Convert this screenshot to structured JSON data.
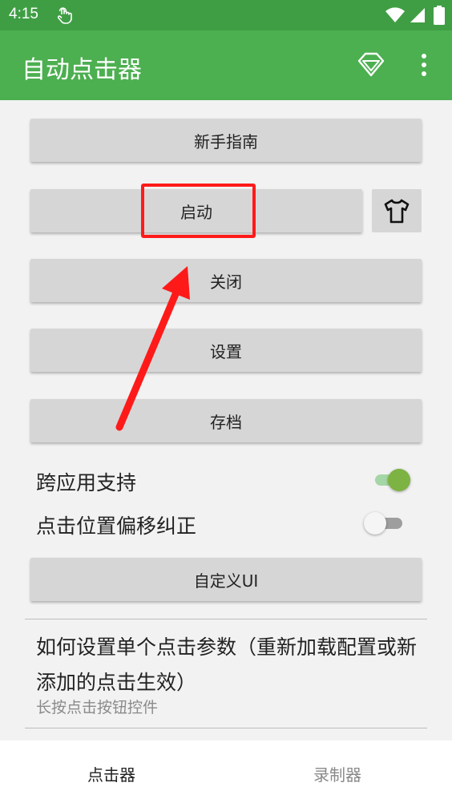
{
  "status_bar": {
    "time": "4:15",
    "icons": [
      "touch-icon",
      "wifi-icon",
      "cell-signal-icon",
      "battery-icon"
    ]
  },
  "app_bar": {
    "title": "自动点击器",
    "actions": [
      "diamond-icon",
      "more-vert-icon"
    ]
  },
  "buttons": {
    "guide": "新手指南",
    "start": "启动",
    "skin_icon": "tshirt-icon",
    "close": "关闭",
    "settings": "设置",
    "archive": "存档",
    "custom_ui": "自定义UI"
  },
  "toggles": [
    {
      "label": "跨应用支持",
      "on": true
    },
    {
      "label": "点击位置偏移纠正",
      "on": false
    }
  ],
  "help": {
    "title": "如何设置单个点击参数（重新加载配置或新添加的点击生效）",
    "subtitle": "长按点击按钮控件"
  },
  "bottom_nav": {
    "tabs": [
      "点击器",
      "录制器"
    ],
    "selected": "点击器"
  },
  "colors": {
    "status_bar": "#3f9e44",
    "app_bar": "#4caf50",
    "annotation": "#ff1a1a",
    "switch_on": "#7cb342"
  }
}
